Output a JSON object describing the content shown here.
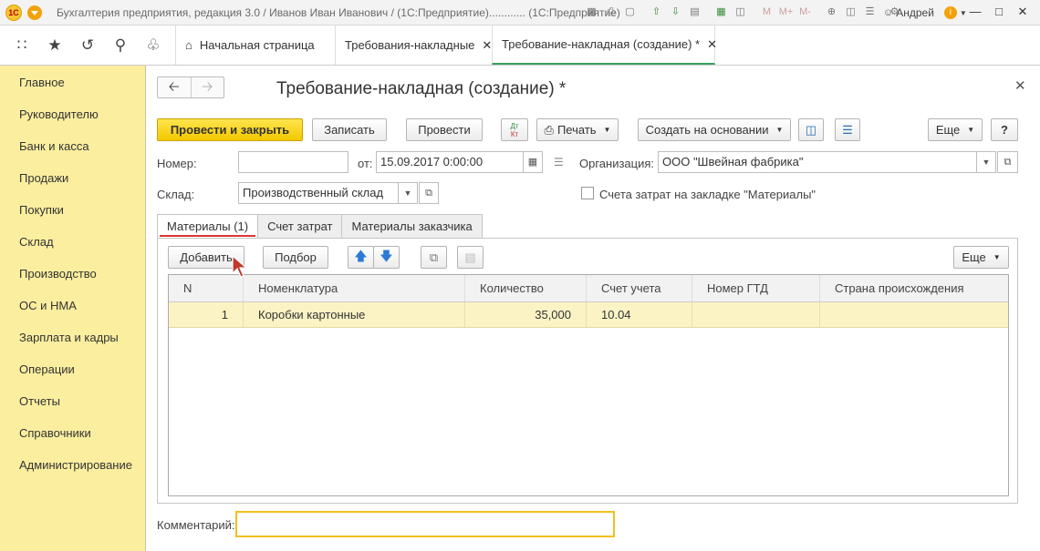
{
  "window": {
    "logo": "1С",
    "title": "Бухгалтерия предприятия, редакция 3.0 / Иванов Иван Иванович / (1С:Предприятие)............  (1С:Предприятие)",
    "toolbar_m": "M",
    "toolbar_mplus": "M+",
    "toolbar_mminus": "M-",
    "user": "Андрей"
  },
  "tabs": [
    {
      "label": "Начальная страница"
    },
    {
      "label": "Требования-накладные"
    },
    {
      "label": "Требование-накладная (создание) *"
    }
  ],
  "sidebar": {
    "items": [
      {
        "label": "Главное"
      },
      {
        "label": "Руководителю"
      },
      {
        "label": "Банк и касса"
      },
      {
        "label": "Продажи"
      },
      {
        "label": "Покупки"
      },
      {
        "label": "Склад"
      },
      {
        "label": "Производство"
      },
      {
        "label": "ОС и НМА"
      },
      {
        "label": "Зарплата и кадры"
      },
      {
        "label": "Операции"
      },
      {
        "label": "Отчеты"
      },
      {
        "label": "Справочники"
      },
      {
        "label": "Администрирование"
      }
    ]
  },
  "form": {
    "title": "Требование-накладная (создание) *",
    "buttons": {
      "post_close": "Провести и закрыть",
      "save": "Записать",
      "post": "Провести",
      "dtkt_top": "Дт",
      "dtkt_bottom": "Кт",
      "print": "Печать",
      "create_based": "Создать на основании",
      "more": "Еще",
      "help": "?"
    },
    "number_label": "Номер:",
    "number_value": "",
    "date_label": "от:",
    "date_value": "15.09.2017  0:00:00",
    "org_label": "Организация:",
    "org_value": "ООО \"Швейная фабрика\"",
    "warehouse_label": "Склад:",
    "warehouse_value": "Производственный склад",
    "cost_accounts_label": "Счета затрат на закладке \"Материалы\"",
    "tabs": [
      {
        "label": "Материалы (1)"
      },
      {
        "label": "Счет затрат"
      },
      {
        "label": "Материалы заказчика"
      }
    ],
    "table_toolbar": {
      "add": "Добавить",
      "pick": "Подбор",
      "more": "Еще"
    },
    "table": {
      "columns": [
        "N",
        "Номенклатура",
        "Количество",
        "Счет учета",
        "Номер ГТД",
        "Страна происхождения"
      ],
      "rows": [
        {
          "n": "1",
          "item": "Коробки картонные",
          "qty": "35,000",
          "account": "10.04",
          "gtd": "",
          "country": ""
        }
      ]
    },
    "comment_label": "Комментарий:",
    "comment_value": ""
  }
}
